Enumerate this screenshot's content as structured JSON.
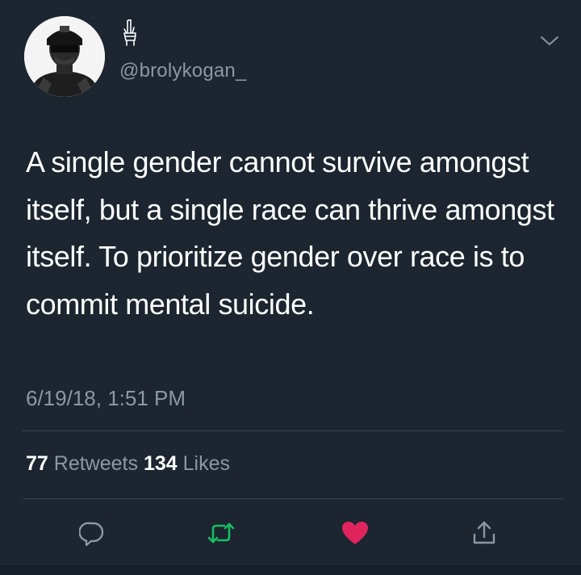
{
  "tweet": {
    "handle": "@brolykogan_",
    "display_name_icon": "hand-glyph-icon",
    "text": "A single gender cannot survive amongst itself, but a single race can thrive amongst itself. To prioritize gender over race is to commit mental suicide.",
    "timestamp": "6/19/18, 1:51 PM",
    "retweets_count": "77",
    "retweets_label": "Retweets",
    "likes_count": "134",
    "likes_label": "Likes",
    "liked": true
  },
  "colors": {
    "background": "#1c2530",
    "text": "#ffffff",
    "muted": "#8b98a5",
    "retweet": "#17bf63",
    "like": "#e0245e",
    "divider": "#38444d"
  },
  "icons": {
    "menu": "chevron-down-icon",
    "reply": "reply-icon",
    "retweet": "retweet-icon",
    "like": "heart-icon",
    "share": "share-icon"
  }
}
